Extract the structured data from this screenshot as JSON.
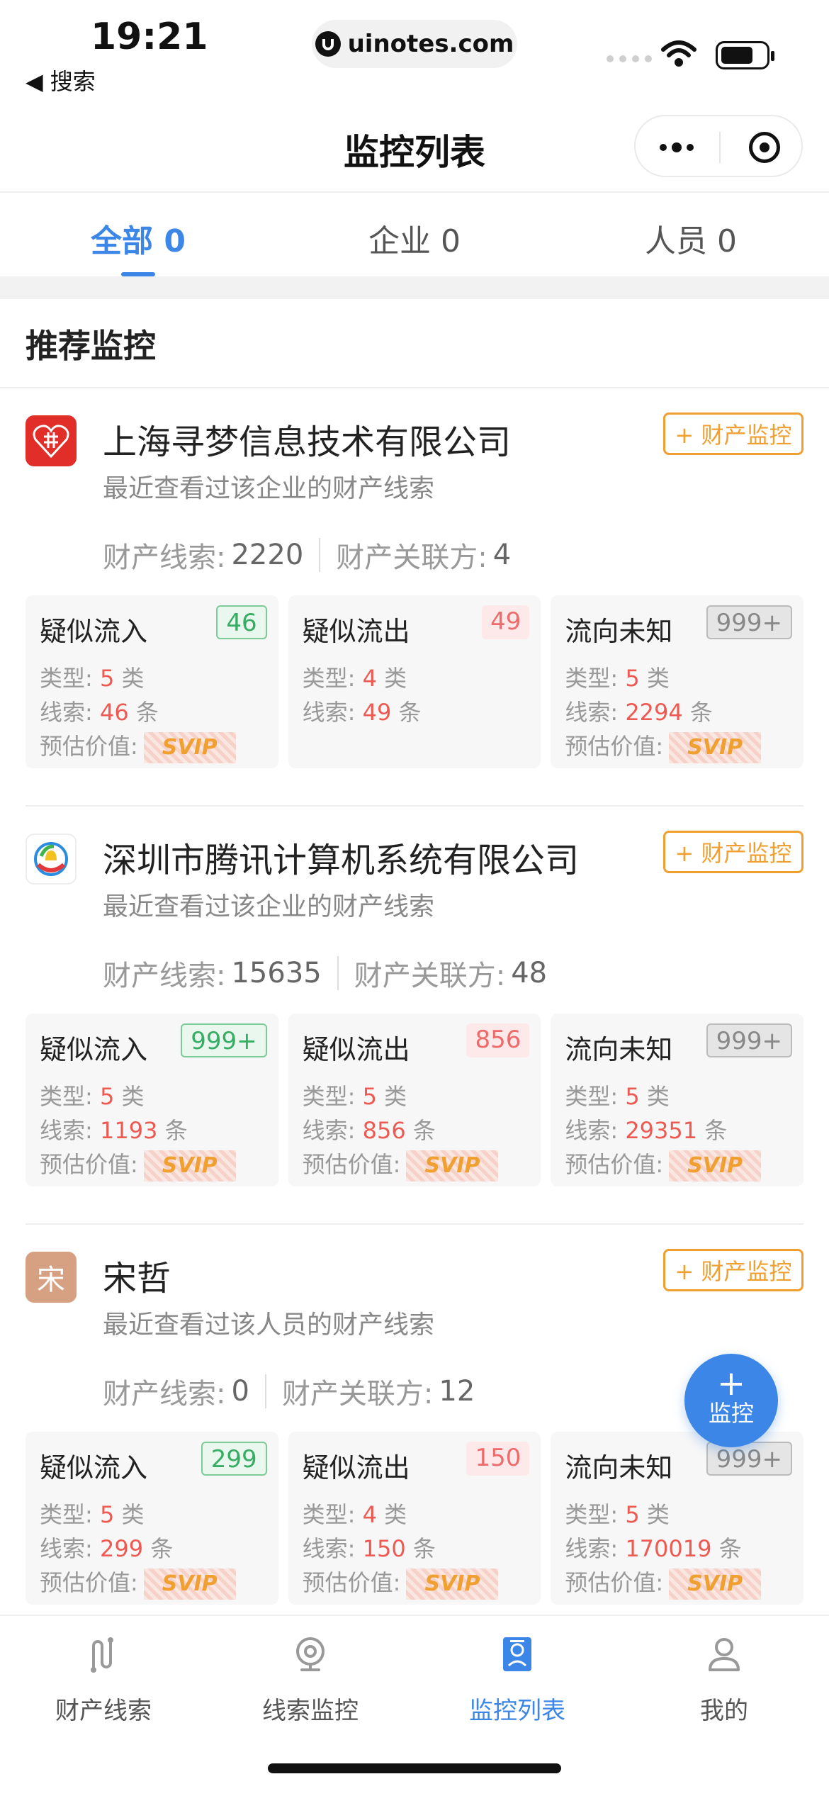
{
  "status_bar": {
    "time": "19:21",
    "back_label": "◀ 搜索",
    "url": "uinotes.com"
  },
  "nav": {
    "title": "监控列表"
  },
  "tabs": [
    {
      "label": "全部 0",
      "active": true
    },
    {
      "label": "企业 0",
      "active": false
    },
    {
      "label": "人员 0",
      "active": false
    }
  ],
  "section_title": "推荐监控",
  "cards": [
    {
      "name": "上海寻梦信息技术有限公司",
      "desc": "最近查看过该企业的财产线索",
      "button": "+ 财产监控",
      "stats": {
        "clue_label": "财产线索:",
        "clue_value": "2220",
        "related_label": "财产关联方:",
        "related_value": "4"
      },
      "boxes": [
        {
          "title": "疑似流入",
          "badge": "46",
          "type_label": "类型:",
          "type_value": "5",
          "type_unit": "类",
          "clue_label": "线索:",
          "clue_value": "46",
          "clue_unit": "条",
          "value_label": "预估价值:",
          "vip": "SVIP"
        },
        {
          "title": "疑似流出",
          "badge": "49",
          "type_label": "类型:",
          "type_value": "4",
          "type_unit": "类",
          "clue_label": "线索:",
          "clue_value": "49",
          "clue_unit": "条",
          "value_label": "",
          "vip": ""
        },
        {
          "title": "流向未知",
          "badge": "999+",
          "type_label": "类型:",
          "type_value": "5",
          "type_unit": "类",
          "clue_label": "线索:",
          "clue_value": "2294",
          "clue_unit": "条",
          "value_label": "预估价值:",
          "vip": "SVIP"
        }
      ]
    },
    {
      "name": "深圳市腾讯计算机系统有限公司",
      "desc": "最近查看过该企业的财产线索",
      "button": "+ 财产监控",
      "stats": {
        "clue_label": "财产线索:",
        "clue_value": "15635",
        "related_label": "财产关联方:",
        "related_value": "48"
      },
      "boxes": [
        {
          "title": "疑似流入",
          "badge": "999+",
          "type_label": "类型:",
          "type_value": "5",
          "type_unit": "类",
          "clue_label": "线索:",
          "clue_value": "1193",
          "clue_unit": "条",
          "value_label": "预估价值:",
          "vip": "SVIP"
        },
        {
          "title": "疑似流出",
          "badge": "856",
          "type_label": "类型:",
          "type_value": "5",
          "type_unit": "类",
          "clue_label": "线索:",
          "clue_value": "856",
          "clue_unit": "条",
          "value_label": "预估价值:",
          "vip": "SVIP"
        },
        {
          "title": "流向未知",
          "badge": "999+",
          "type_label": "类型:",
          "type_value": "5",
          "type_unit": "类",
          "clue_label": "线索:",
          "clue_value": "29351",
          "clue_unit": "条",
          "value_label": "预估价值:",
          "vip": "SVIP"
        }
      ]
    },
    {
      "name": "宋哲",
      "avatar_text": "宋",
      "desc": "最近查看过该人员的财产线索",
      "button": "+ 财产监控",
      "stats": {
        "clue_label": "财产线索:",
        "clue_value": "0",
        "related_label": "财产关联方:",
        "related_value": "12"
      },
      "boxes": [
        {
          "title": "疑似流入",
          "badge": "299",
          "type_label": "类型:",
          "type_value": "5",
          "type_unit": "类",
          "clue_label": "线索:",
          "clue_value": "299",
          "clue_unit": "条",
          "value_label": "预估价值:",
          "vip": "SVIP"
        },
        {
          "title": "疑似流出",
          "badge": "150",
          "type_label": "类型:",
          "type_value": "4",
          "type_unit": "类",
          "clue_label": "线索:",
          "clue_value": "150",
          "clue_unit": "条",
          "value_label": "预估价值:",
          "vip": "SVIP"
        },
        {
          "title": "流向未知",
          "badge": "999+",
          "type_label": "类型:",
          "type_value": "5",
          "type_unit": "类",
          "clue_label": "线索:",
          "clue_value": "170019",
          "clue_unit": "条",
          "value_label": "预估价值:",
          "vip": "SVIP"
        }
      ]
    }
  ],
  "fab": {
    "plus": "+",
    "label": "监控"
  },
  "tabbar": [
    {
      "label": "财产线索",
      "icon": "path-icon",
      "active": false
    },
    {
      "label": "线索监控",
      "icon": "camera-icon",
      "active": false
    },
    {
      "label": "监控列表",
      "icon": "list-icon",
      "active": true
    },
    {
      "label": "我的",
      "icon": "user-icon",
      "active": false
    }
  ],
  "colors": {
    "accent": "#3b86e6",
    "orange": "#f0a030",
    "red": "#ee5a52",
    "green": "#37ad63"
  }
}
